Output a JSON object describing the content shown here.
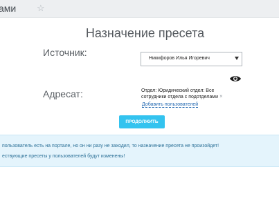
{
  "header": {
    "breadcrumb": "ами",
    "star_glyph": "☆"
  },
  "dialog": {
    "title": "Назначение пресета",
    "source_label": "Источник:",
    "source_value": "Никифоров Илья Игоревич",
    "target_label": "Адресат:",
    "target_value": "Отдел: Юридический отдел: Все сотрудники отдела с подотделами",
    "remove_glyph": "×",
    "add_users_link": "Добавить пользователей",
    "eye_icon": "eye-icon",
    "continue_button": "ПРОДОЛЖИТЬ"
  },
  "notice": {
    "line1": "пользователь есть на портале, но он ни разу не заходил, то назначение пресета не произойдет!",
    "line2": "ествующие пресеты у пользователей будут изменены!"
  },
  "colors": {
    "accent_button": "#33c3ef",
    "link": "#2067b0",
    "notice_bg": "#e4f4fc",
    "notice_text": "#2a6f96"
  }
}
